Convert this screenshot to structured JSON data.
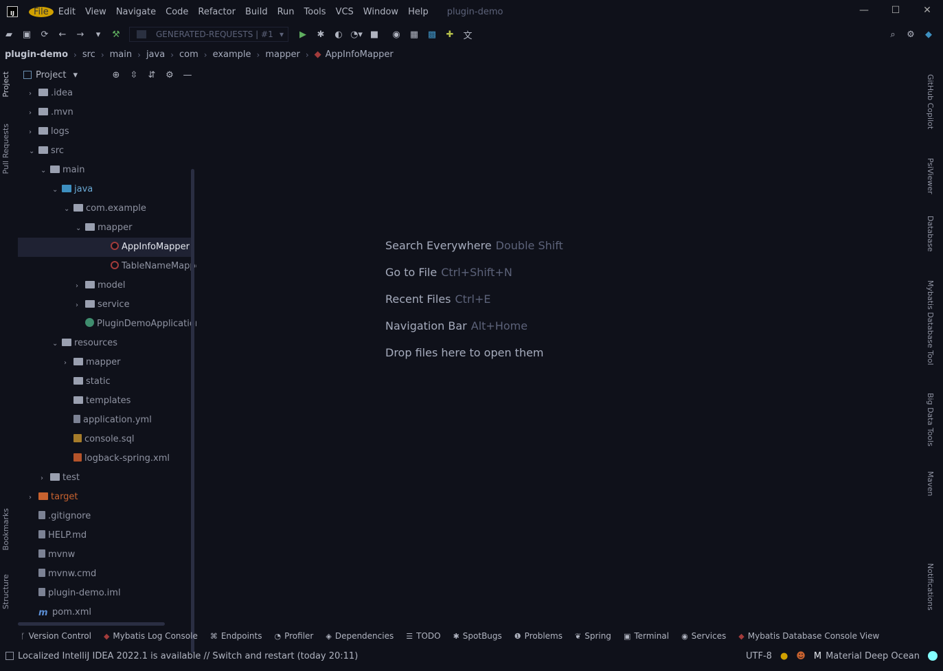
{
  "titlebar": {
    "menu": [
      "File",
      "Edit",
      "View",
      "Navigate",
      "Code",
      "Refactor",
      "Build",
      "Run",
      "Tools",
      "VCS",
      "Window",
      "Help"
    ],
    "project_title": "plugin-demo"
  },
  "toolbar": {
    "run_config": "GENERATED-REQUESTS | #1"
  },
  "breadcrumb": [
    "plugin-demo",
    "src",
    "main",
    "java",
    "com",
    "example",
    "mapper",
    "AppInfoMapper"
  ],
  "left_tabs": {
    "project": "Project",
    "pull_requests": "Pull Requests",
    "bookmarks": "Bookmarks",
    "structure": "Structure"
  },
  "project_panel": {
    "title": "Project",
    "tree": [
      {
        "label": ".idea",
        "depth": 0,
        "arrow": "›",
        "icon": "folder"
      },
      {
        "label": ".mvn",
        "depth": 0,
        "arrow": "›",
        "icon": "folder"
      },
      {
        "label": "logs",
        "depth": 0,
        "arrow": "›",
        "icon": "folder"
      },
      {
        "label": "src",
        "depth": 0,
        "arrow": "⌄",
        "icon": "folder"
      },
      {
        "label": "main",
        "depth": 1,
        "arrow": "⌄",
        "icon": "folder"
      },
      {
        "label": "java",
        "depth": 2,
        "arrow": "⌄",
        "icon": "folder-blue"
      },
      {
        "label": "com.example",
        "depth": 3,
        "arrow": "⌄",
        "icon": "pkg"
      },
      {
        "label": "mapper",
        "depth": 4,
        "arrow": "⌄",
        "icon": "pkg"
      },
      {
        "label": "AppInfoMapper",
        "depth": 5,
        "arrow": "",
        "icon": "java",
        "selected": true
      },
      {
        "label": "TableNameMapper",
        "depth": 5,
        "arrow": "",
        "icon": "java"
      },
      {
        "label": "model",
        "depth": 4,
        "arrow": "›",
        "icon": "pkg"
      },
      {
        "label": "service",
        "depth": 4,
        "arrow": "›",
        "icon": "pkg"
      },
      {
        "label": "PluginDemoApplication",
        "depth": 4,
        "arrow": "",
        "icon": "boot"
      },
      {
        "label": "resources",
        "depth": 2,
        "arrow": "⌄",
        "icon": "folder"
      },
      {
        "label": "mapper",
        "depth": 3,
        "arrow": "›",
        "icon": "folder"
      },
      {
        "label": "static",
        "depth": 3,
        "arrow": "",
        "icon": "folder"
      },
      {
        "label": "templates",
        "depth": 3,
        "arrow": "",
        "icon": "folder"
      },
      {
        "label": "application.yml",
        "depth": 3,
        "arrow": "",
        "icon": "file"
      },
      {
        "label": "console.sql",
        "depth": 3,
        "arrow": "",
        "icon": "sql"
      },
      {
        "label": "logback-spring.xml",
        "depth": 3,
        "arrow": "",
        "icon": "xml"
      },
      {
        "label": "test",
        "depth": 1,
        "arrow": "›",
        "icon": "folder"
      },
      {
        "label": "target",
        "depth": 0,
        "arrow": "›",
        "icon": "folder-orange"
      },
      {
        "label": ".gitignore",
        "depth": 0,
        "arrow": "",
        "icon": "file"
      },
      {
        "label": "HELP.md",
        "depth": 0,
        "arrow": "",
        "icon": "file"
      },
      {
        "label": "mvnw",
        "depth": 0,
        "arrow": "",
        "icon": "file"
      },
      {
        "label": "mvnw.cmd",
        "depth": 0,
        "arrow": "",
        "icon": "file"
      },
      {
        "label": "plugin-demo.iml",
        "depth": 0,
        "arrow": "",
        "icon": "file"
      },
      {
        "label": "pom.xml",
        "depth": 0,
        "arrow": "",
        "icon": "mvn"
      }
    ]
  },
  "editor_hints": [
    {
      "action": "Search Everywhere",
      "shortcut": "Double Shift"
    },
    {
      "action": "Go to File",
      "shortcut": "Ctrl+Shift+N"
    },
    {
      "action": "Recent Files",
      "shortcut": "Ctrl+E"
    },
    {
      "action": "Navigation Bar",
      "shortcut": "Alt+Home"
    },
    {
      "action": "Drop files here to open them",
      "shortcut": ""
    }
  ],
  "right_tabs": [
    "GitHub Copilot",
    "PsiViewer",
    "Database",
    "Mybatis Database Tool",
    "Big Data Tools",
    "Maven",
    "Notifications"
  ],
  "tool_windows": [
    "Version Control",
    "Mybatis Log Console",
    "Endpoints",
    "Profiler",
    "Dependencies",
    "TODO",
    "SpotBugs",
    "Problems",
    "Spring",
    "Terminal",
    "Services",
    "Mybatis Database Console View"
  ],
  "statusbar": {
    "message": "Localized IntelliJ IDEA 2022.1 is available // Switch and restart (today 20:11)",
    "encoding": "UTF-8",
    "theme": "Material Deep Ocean"
  }
}
